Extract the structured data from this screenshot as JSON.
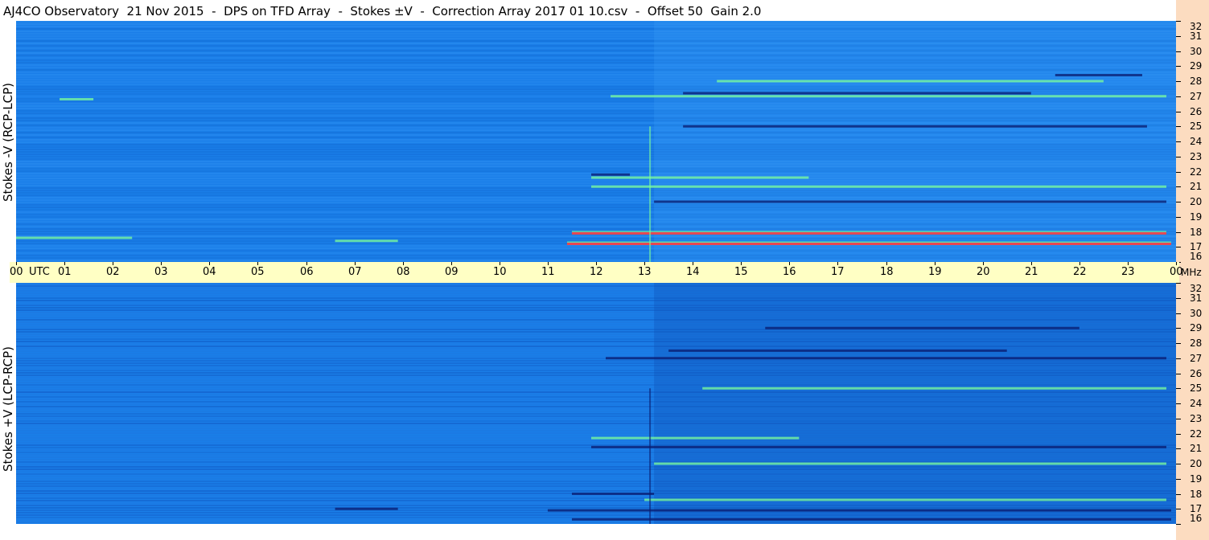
{
  "header": {
    "title": "AJ4CO Observatory  21 Nov 2015  -  DPS on TFD Array  -  Stokes ±V  -  Correction Array 2017 01 10.csv  -  Offset 50  Gain 2.0"
  },
  "panels": {
    "top_label": "Stokes -V (RCP-LCP)",
    "bottom_label": "Stokes +V (LCP-RCP)"
  },
  "colors": {
    "background": "#1a7ee8",
    "strong_positive": "#ff4040",
    "positive": "#7dff9a",
    "negative": "#0a1a6e",
    "time_axis_bg": "#ffffc4",
    "freq_axis_bg": "#fcdcc0"
  },
  "chart_data": {
    "type": "heatmap",
    "title": "AJ4CO Observatory  21 Nov 2015  -  DPS on TFD Array  -  Stokes ±V  -  Correction Array 2017 01 10.csv  -  Offset 50  Gain 2.0",
    "x_axis": {
      "unit": "UTC",
      "ticks": [
        "00",
        "01",
        "02",
        "03",
        "04",
        "05",
        "06",
        "07",
        "08",
        "09",
        "10",
        "11",
        "12",
        "13",
        "14",
        "15",
        "16",
        "17",
        "18",
        "19",
        "20",
        "21",
        "22",
        "23",
        "00"
      ],
      "range_hours": [
        0,
        24
      ]
    },
    "y_axis": {
      "unit": "MHz",
      "ticks": [
        "16",
        "17",
        "18",
        "19",
        "20",
        "21",
        "22",
        "23",
        "24",
        "25",
        "26",
        "27",
        "28",
        "29",
        "30",
        "31",
        "32"
      ],
      "range_mhz": [
        16,
        32
      ]
    },
    "panels": [
      {
        "name": "Stokes -V (RCP-LCP)",
        "features": [
          {
            "freq": 17.2,
            "start": 11.4,
            "end": 23.9,
            "level": "strong"
          },
          {
            "freq": 17.4,
            "start": 6.6,
            "end": 7.9,
            "level": "mid"
          },
          {
            "freq": 17.6,
            "start": 0.0,
            "end": 2.4,
            "level": "mid"
          },
          {
            "freq": 17.9,
            "start": 11.5,
            "end": 23.8,
            "level": "strong"
          },
          {
            "freq": 20.0,
            "start": 13.2,
            "end": 23.8,
            "level": "negative"
          },
          {
            "freq": 21.0,
            "start": 11.9,
            "end": 23.8,
            "level": "mid"
          },
          {
            "freq": 21.6,
            "start": 11.9,
            "end": 16.4,
            "level": "mid"
          },
          {
            "freq": 21.8,
            "start": 11.9,
            "end": 12.7,
            "level": "negative"
          },
          {
            "freq": 25.0,
            "start": 13.8,
            "end": 23.4,
            "level": "negative"
          },
          {
            "freq": 27.0,
            "start": 12.3,
            "end": 23.8,
            "level": "mid"
          },
          {
            "freq": 27.2,
            "start": 13.8,
            "end": 21.0,
            "level": "negative"
          },
          {
            "freq": 26.8,
            "start": 0.9,
            "end": 1.6,
            "level": "mid"
          },
          {
            "freq": 28.0,
            "start": 14.5,
            "end": 22.5,
            "level": "mid"
          },
          {
            "freq": 28.4,
            "start": 21.5,
            "end": 23.3,
            "level": "negative"
          }
        ]
      },
      {
        "name": "Stokes +V (LCP-RCP)",
        "features": [
          {
            "freq": 16.3,
            "start": 11.5,
            "end": 23.9,
            "level": "negative"
          },
          {
            "freq": 16.9,
            "start": 11.0,
            "end": 23.9,
            "level": "negative"
          },
          {
            "freq": 17.0,
            "start": 6.6,
            "end": 7.9,
            "level": "negative"
          },
          {
            "freq": 17.6,
            "start": 13.0,
            "end": 23.8,
            "level": "mid"
          },
          {
            "freq": 18.0,
            "start": 11.5,
            "end": 13.2,
            "level": "negative"
          },
          {
            "freq": 20.0,
            "start": 13.2,
            "end": 23.8,
            "level": "mid"
          },
          {
            "freq": 21.1,
            "start": 11.9,
            "end": 23.8,
            "level": "negative"
          },
          {
            "freq": 21.7,
            "start": 11.9,
            "end": 16.2,
            "level": "mid"
          },
          {
            "freq": 25.0,
            "start": 14.2,
            "end": 23.8,
            "level": "mid"
          },
          {
            "freq": 27.0,
            "start": 12.2,
            "end": 23.8,
            "level": "negative"
          },
          {
            "freq": 27.5,
            "start": 13.5,
            "end": 20.5,
            "level": "negative"
          },
          {
            "freq": 29.0,
            "start": 15.5,
            "end": 22.0,
            "level": "negative"
          }
        ]
      }
    ]
  }
}
